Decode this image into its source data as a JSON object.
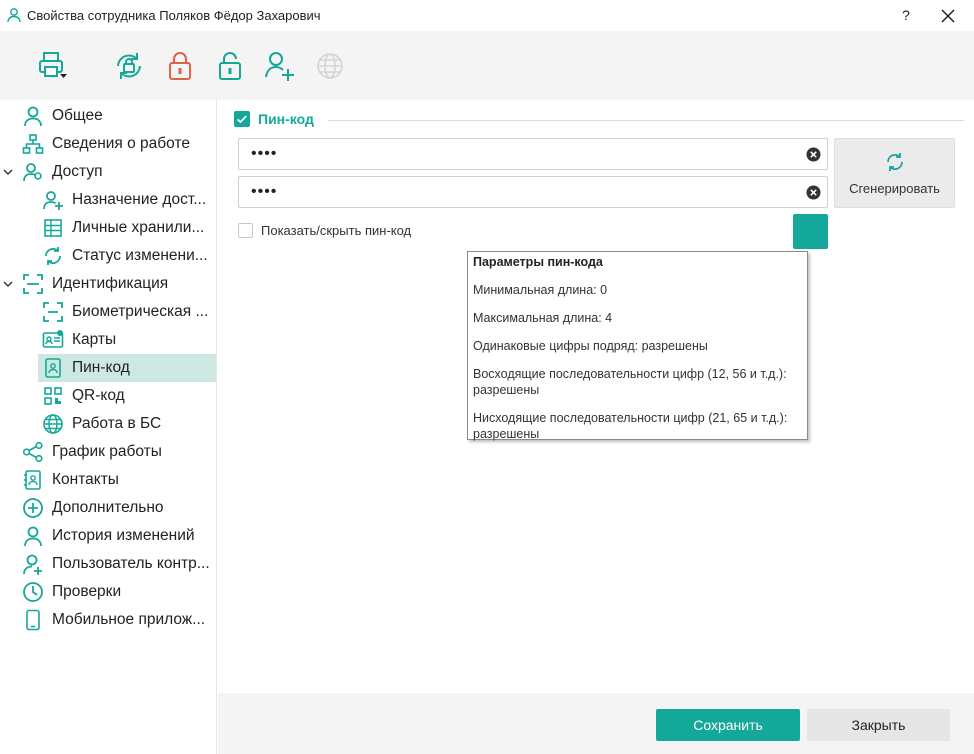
{
  "window": {
    "title": "Свойства сотрудника Поляков Фёдор Захарович",
    "help_label": "?"
  },
  "toolbar": {
    "buttons": [
      "print-icon",
      "sync-lock-icon",
      "lock-red-icon",
      "unlock-icon",
      "add-user-icon",
      "globe-icon-disabled"
    ]
  },
  "sidebar": {
    "items": [
      {
        "label": "Общее",
        "icon": "user-icon"
      },
      {
        "label": "Сведения о работе",
        "icon": "org-chart-icon"
      },
      {
        "label": "Доступ",
        "icon": "users-icon",
        "expanded": true
      },
      {
        "label": "Назначение дост...",
        "icon": "user-add-icon"
      },
      {
        "label": "Личные хранили...",
        "icon": "grid-icon"
      },
      {
        "label": "Статус изменени...",
        "icon": "refresh-icon"
      },
      {
        "label": "Идентификация",
        "icon": "scan-icon",
        "expanded": true
      },
      {
        "label": "Биометрическая ...",
        "icon": "face-scan-icon"
      },
      {
        "label": "Карты",
        "icon": "id-card-icon"
      },
      {
        "label": "Пин-код",
        "icon": "pin-icon",
        "selected": true
      },
      {
        "label": "QR-код",
        "icon": "qr-icon"
      },
      {
        "label": "Работа в БС",
        "icon": "globe-icon"
      },
      {
        "label": "График работы",
        "icon": "share-icon"
      },
      {
        "label": "Контакты",
        "icon": "contacts-icon"
      },
      {
        "label": "Дополнительно",
        "icon": "plus-circle-icon"
      },
      {
        "label": "История изменений",
        "icon": "user-history-icon"
      },
      {
        "label": "Пользователь контр...",
        "icon": "user-plus-icon"
      },
      {
        "label": "Проверки",
        "icon": "clock-icon"
      },
      {
        "label": "Мобильное прилож...",
        "icon": "phone-icon"
      }
    ]
  },
  "main": {
    "section_title": "Пин-код",
    "pin_value_1": "••••",
    "pin_value_2": "••••",
    "generate_label": "Сгенерировать",
    "show_hide_label": "Показать/скрыть пин-код"
  },
  "tooltip": {
    "title": "Параметры пин-кода",
    "min_length": "Минимальная длина: 0",
    "max_length": "Максимальная длина: 4",
    "same_digits": "Одинаковые цифры подряд: разрешены",
    "ascending_1": "Восходящие последовательности цифр (12, 56 и т.д.):",
    "ascending_2": "разрешены",
    "descending_1": "Нисходящие последовательности цифр (21, 65 и т.д.):",
    "descending_2": "разрешены"
  },
  "footer": {
    "save_label": "Сохранить",
    "close_label": "Закрыть"
  },
  "colors": {
    "accent": "#14a89a",
    "selected_bg": "#cde7e3",
    "lock_red": "#e0624a"
  }
}
